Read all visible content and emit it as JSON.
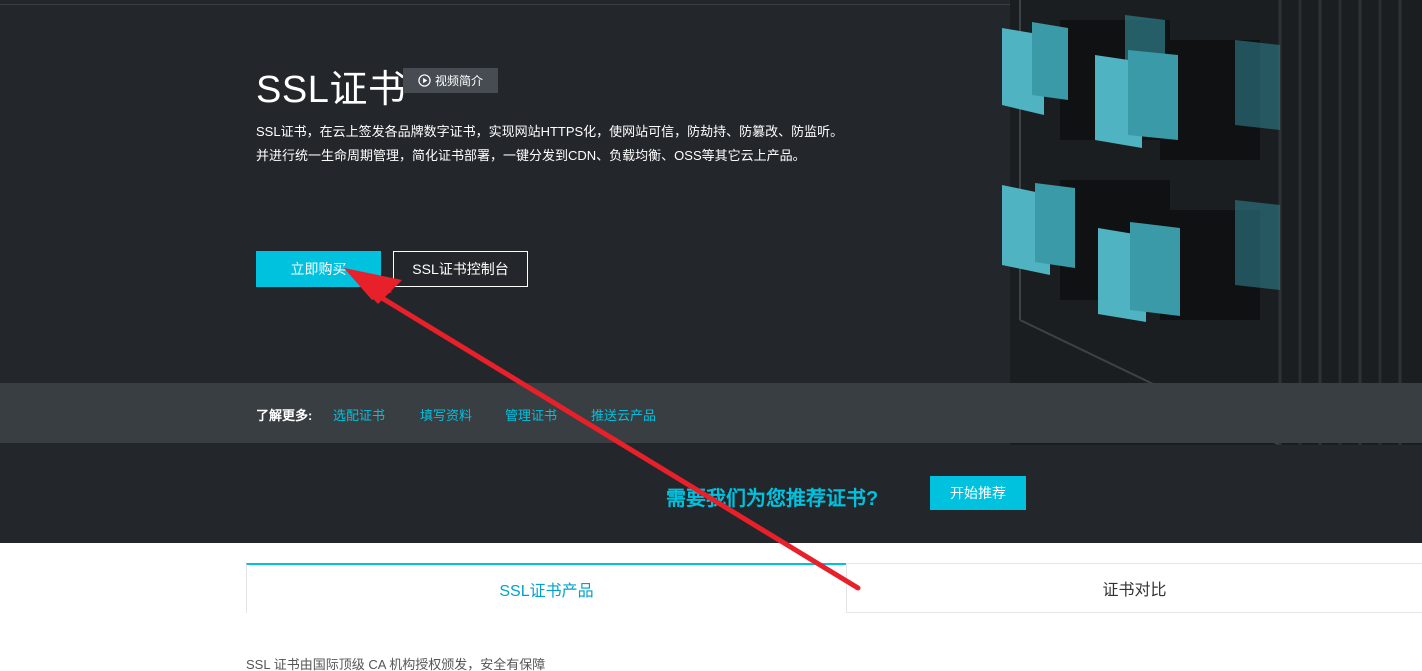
{
  "hero": {
    "title": "SSL证书",
    "video_label": "视频简介",
    "desc_line1": "SSL证书，在云上签发各品牌数字证书，实现网站HTTPS化，使网站可信，防劫持、防篡改、防监听。",
    "desc_line2": "并进行统一生命周期管理，简化证书部署，一键分发到CDN、负载均衡、OSS等其它云上产品。",
    "buy_label": "立即购买",
    "console_label": "SSL证书控制台"
  },
  "learn_more": {
    "label": "了解更多:",
    "links": [
      "选配证书",
      "填写资料",
      "管理证书",
      "推送云产品"
    ]
  },
  "recommend": {
    "question": "需要我们为您推荐证书?",
    "button": "开始推荐"
  },
  "tabs": [
    "SSL证书产品",
    "证书对比"
  ],
  "intro_text": "SSL 证书由国际顶级 CA 机构授权颁发，安全有保障",
  "colors": {
    "accent": "#00c1de",
    "hero_bg": "#23272b",
    "bar_bg": "#393e43",
    "annotation_arrow": "#e8202a"
  },
  "icons": {
    "video": "play-circle-icon"
  }
}
